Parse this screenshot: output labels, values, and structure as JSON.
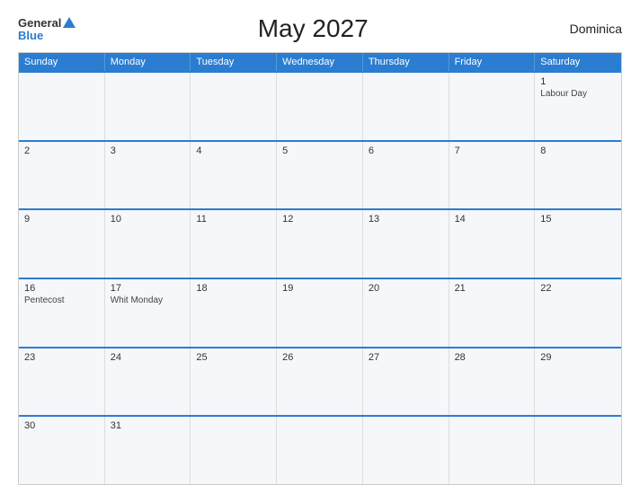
{
  "header": {
    "logo": {
      "general": "General",
      "blue": "Blue"
    },
    "title": "May 2027",
    "country": "Dominica"
  },
  "calendar": {
    "days_of_week": [
      "Sunday",
      "Monday",
      "Tuesday",
      "Wednesday",
      "Thursday",
      "Friday",
      "Saturday"
    ],
    "weeks": [
      [
        {
          "day": "",
          "event": ""
        },
        {
          "day": "",
          "event": ""
        },
        {
          "day": "",
          "event": ""
        },
        {
          "day": "",
          "event": ""
        },
        {
          "day": "",
          "event": ""
        },
        {
          "day": "",
          "event": ""
        },
        {
          "day": "1",
          "event": "Labour Day"
        }
      ],
      [
        {
          "day": "2",
          "event": ""
        },
        {
          "day": "3",
          "event": ""
        },
        {
          "day": "4",
          "event": ""
        },
        {
          "day": "5",
          "event": ""
        },
        {
          "day": "6",
          "event": ""
        },
        {
          "day": "7",
          "event": ""
        },
        {
          "day": "8",
          "event": ""
        }
      ],
      [
        {
          "day": "9",
          "event": ""
        },
        {
          "day": "10",
          "event": ""
        },
        {
          "day": "11",
          "event": ""
        },
        {
          "day": "12",
          "event": ""
        },
        {
          "day": "13",
          "event": ""
        },
        {
          "day": "14",
          "event": ""
        },
        {
          "day": "15",
          "event": ""
        }
      ],
      [
        {
          "day": "16",
          "event": "Pentecost"
        },
        {
          "day": "17",
          "event": "Whit Monday"
        },
        {
          "day": "18",
          "event": ""
        },
        {
          "day": "19",
          "event": ""
        },
        {
          "day": "20",
          "event": ""
        },
        {
          "day": "21",
          "event": ""
        },
        {
          "day": "22",
          "event": ""
        }
      ],
      [
        {
          "day": "23",
          "event": ""
        },
        {
          "day": "24",
          "event": ""
        },
        {
          "day": "25",
          "event": ""
        },
        {
          "day": "26",
          "event": ""
        },
        {
          "day": "27",
          "event": ""
        },
        {
          "day": "28",
          "event": ""
        },
        {
          "day": "29",
          "event": ""
        }
      ],
      [
        {
          "day": "30",
          "event": ""
        },
        {
          "day": "31",
          "event": ""
        },
        {
          "day": "",
          "event": ""
        },
        {
          "day": "",
          "event": ""
        },
        {
          "day": "",
          "event": ""
        },
        {
          "day": "",
          "event": ""
        },
        {
          "day": "",
          "event": ""
        }
      ]
    ]
  }
}
